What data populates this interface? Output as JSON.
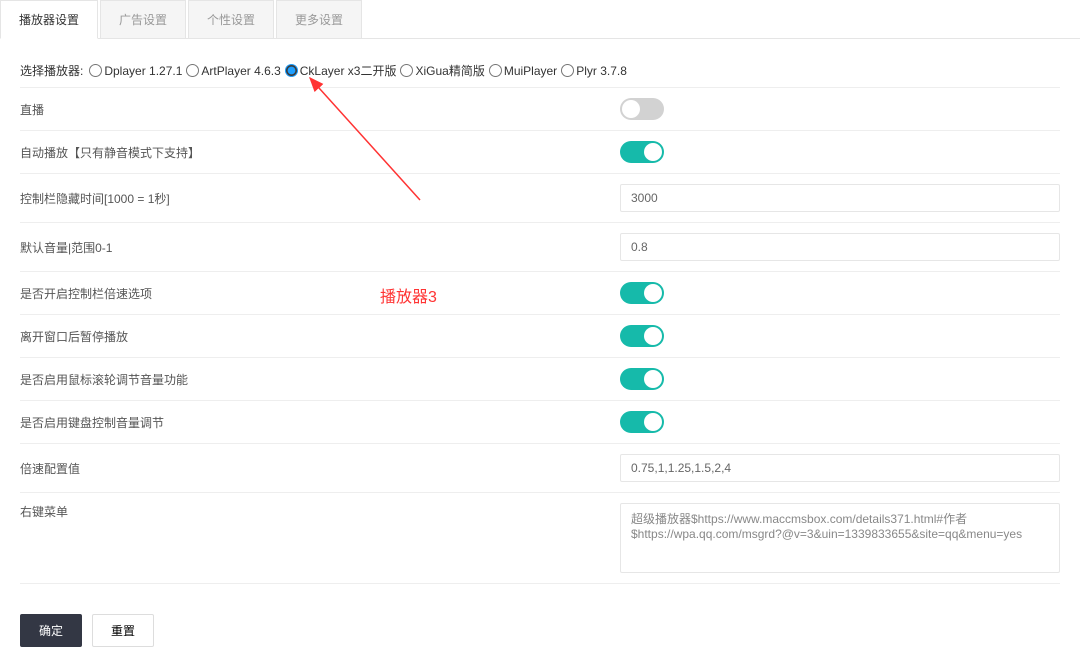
{
  "tabs": {
    "items": [
      {
        "label": "播放器设置",
        "active": true
      },
      {
        "label": "广告设置",
        "active": false
      },
      {
        "label": "个性设置",
        "active": false
      },
      {
        "label": "更多设置",
        "active": false
      }
    ]
  },
  "radio": {
    "label": "选择播放器:",
    "options": [
      {
        "label": "Dplayer 1.27.1",
        "checked": false
      },
      {
        "label": "ArtPlayer 4.6.3",
        "checked": false
      },
      {
        "label": "CkLayer x3二开版",
        "checked": true
      },
      {
        "label": "XiGua精简版",
        "checked": false
      },
      {
        "label": "MuiPlayer",
        "checked": false
      },
      {
        "label": "Plyr 3.7.8",
        "checked": false
      }
    ]
  },
  "rows": {
    "live": {
      "label": "直播",
      "type": "switch",
      "on": false
    },
    "autoplay": {
      "label": "自动播放【只有静音模式下支持】",
      "type": "switch",
      "on": true
    },
    "hidebar": {
      "label": "控制栏隐藏时间[1000 = 1秒]",
      "type": "text",
      "value": "3000"
    },
    "volume": {
      "label": "默认音量|范围0-1",
      "type": "text",
      "value": "0.8"
    },
    "speedbar": {
      "label": "是否开启控制栏倍速选项",
      "type": "switch",
      "on": true
    },
    "pauseblur": {
      "label": "离开窗口后暂停播放",
      "type": "switch",
      "on": true
    },
    "wheelvol": {
      "label": "是否启用鼠标滚轮调节音量功能",
      "type": "switch",
      "on": true
    },
    "keyvol": {
      "label": "是否启用键盘控制音量调节",
      "type": "switch",
      "on": true
    },
    "speedcfg": {
      "label": "倍速配置值",
      "type": "text",
      "value": "0.75,1,1.25,1.5,2,4"
    },
    "contextmenu": {
      "label": "右键菜单",
      "type": "textarea",
      "value": "超级播放器$https://www.maccmsbox.com/details371.html#作者$https://wpa.qq.com/msgrd?@v=3&uin=1339833655&site=qq&menu=yes"
    }
  },
  "annotation": {
    "text": "播放器3"
  },
  "footer": {
    "confirm": "确定",
    "reset": "重置"
  }
}
